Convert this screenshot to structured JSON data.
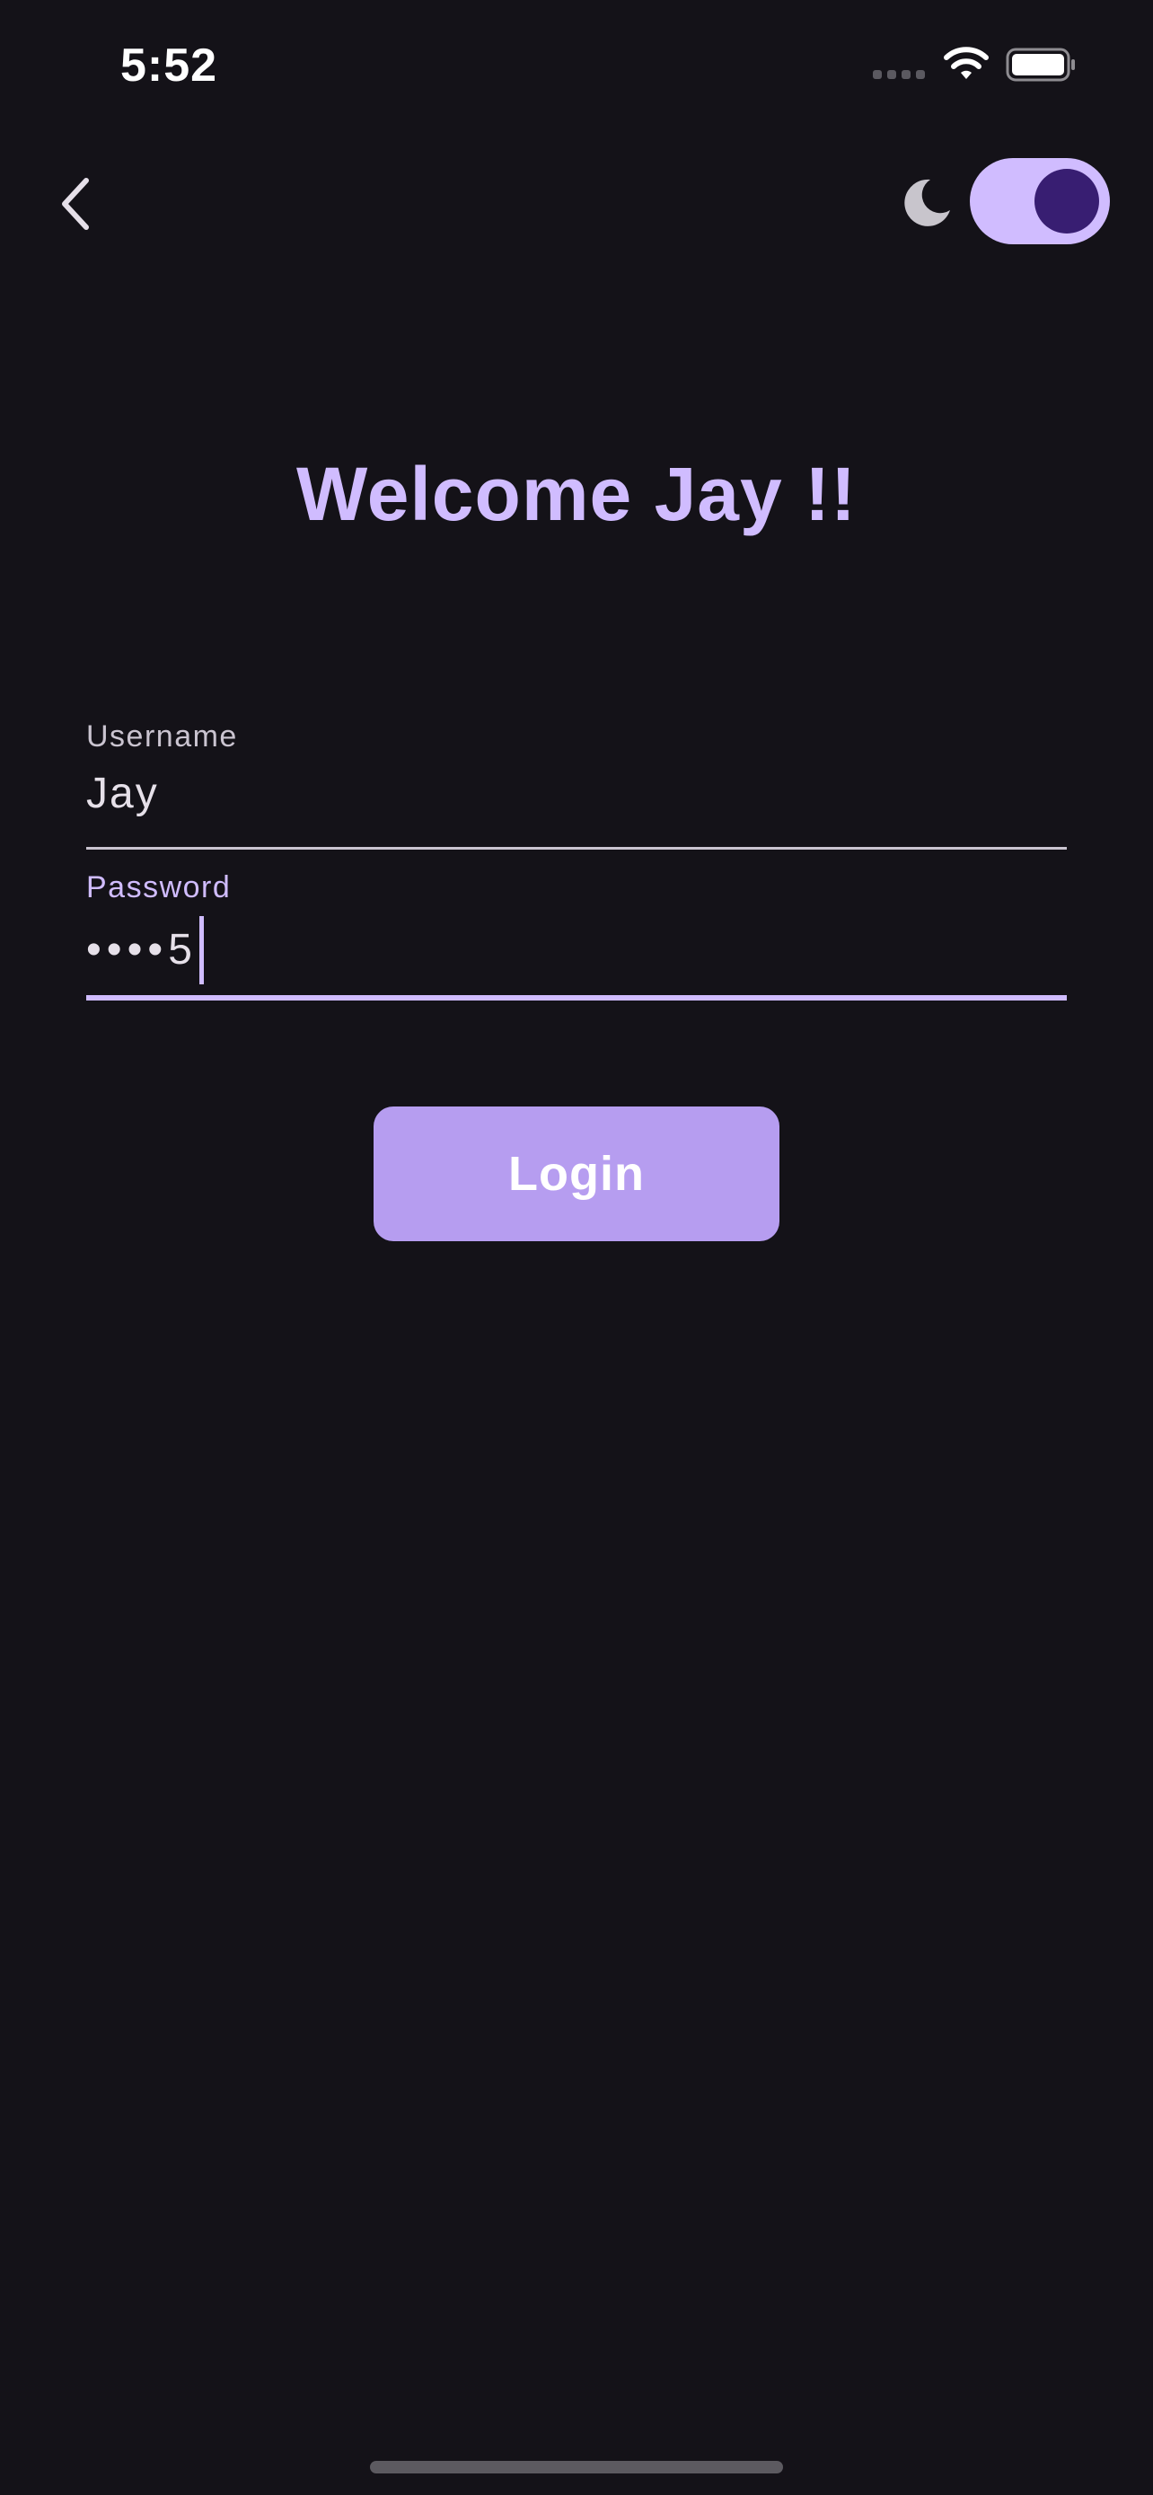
{
  "status_bar": {
    "time": "5:52",
    "wifi_icon": "wifi-icon",
    "battery_icon": "battery-full-icon",
    "signal_icon": "cellular-signal-icon"
  },
  "app_bar": {
    "back_icon": "chevron-left-icon",
    "theme_icon": "moon-icon",
    "dark_mode_enabled": true
  },
  "title": "Welcome Jay !!",
  "form": {
    "username": {
      "label": "Username",
      "value": "Jay"
    },
    "password": {
      "label": "Password",
      "value": "••••5",
      "focused": true
    }
  },
  "login_button": {
    "label": "Login"
  },
  "colors": {
    "background": "#141218",
    "primary": "#d0bcff",
    "button": "#b69df0",
    "toggle_thumb": "#381e72",
    "on_surface": "#e6e0e9",
    "outline": "#cac4d0"
  }
}
